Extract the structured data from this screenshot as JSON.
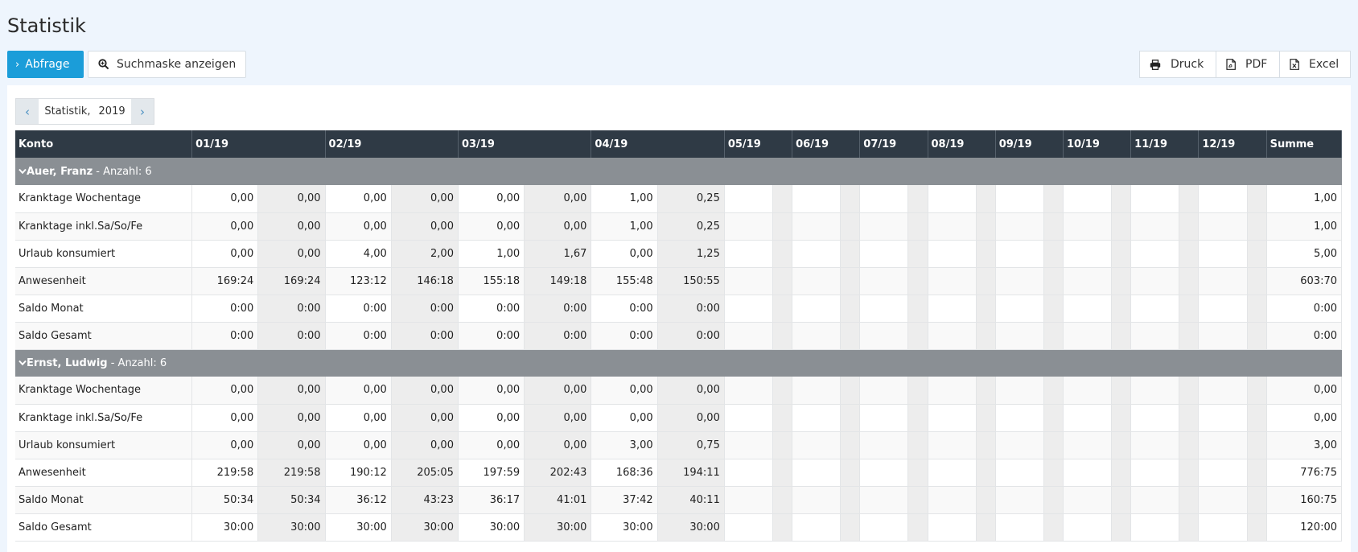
{
  "page": {
    "title": "Statistik"
  },
  "toolbar": {
    "query_label": "Abfrage",
    "search_label": "Suchmaske anzeigen",
    "print_label": "Druck",
    "pdf_label": "PDF",
    "excel_label": "Excel"
  },
  "period": {
    "label": "Statistik,",
    "year": "2019"
  },
  "table": {
    "headers": [
      "Konto",
      "01/19",
      "02/19",
      "03/19",
      "04/19",
      "05/19",
      "06/19",
      "07/19",
      "08/19",
      "09/19",
      "10/19",
      "11/19",
      "12/19",
      "Summe"
    ],
    "groups": [
      {
        "name": "Auer, Franz",
        "count_text": " - Anzahl: 6",
        "rows": [
          {
            "label": "Kranktage Wochentage",
            "values": [
              "0,00",
              "0,00",
              "0,00",
              "0,00",
              "0,00",
              "0,00",
              "1,00",
              "0,25"
            ],
            "sum": "1,00"
          },
          {
            "label": "Kranktage inkl.Sa/So/Fe",
            "values": [
              "0,00",
              "0,00",
              "0,00",
              "0,00",
              "0,00",
              "0,00",
              "1,00",
              "0,25"
            ],
            "sum": "1,00"
          },
          {
            "label": "Urlaub konsumiert",
            "values": [
              "0,00",
              "0,00",
              "4,00",
              "2,00",
              "1,00",
              "1,67",
              "0,00",
              "1,25"
            ],
            "sum": "5,00"
          },
          {
            "label": "Anwesenheit",
            "values": [
              "169:24",
              "169:24",
              "123:12",
              "146:18",
              "155:18",
              "149:18",
              "155:48",
              "150:55"
            ],
            "sum": "603:70"
          },
          {
            "label": "Saldo Monat",
            "values": [
              "0:00",
              "0:00",
              "0:00",
              "0:00",
              "0:00",
              "0:00",
              "0:00",
              "0:00"
            ],
            "sum": "0:00"
          },
          {
            "label": "Saldo Gesamt",
            "values": [
              "0:00",
              "0:00",
              "0:00",
              "0:00",
              "0:00",
              "0:00",
              "0:00",
              "0:00"
            ],
            "sum": "0:00"
          }
        ]
      },
      {
        "name": "Ernst, Ludwig",
        "count_text": " - Anzahl: 6",
        "rows": [
          {
            "label": "Kranktage Wochentage",
            "values": [
              "0,00",
              "0,00",
              "0,00",
              "0,00",
              "0,00",
              "0,00",
              "0,00",
              "0,00"
            ],
            "sum": "0,00"
          },
          {
            "label": "Kranktage inkl.Sa/So/Fe",
            "values": [
              "0,00",
              "0,00",
              "0,00",
              "0,00",
              "0,00",
              "0,00",
              "0,00",
              "0,00"
            ],
            "sum": "0,00"
          },
          {
            "label": "Urlaub konsumiert",
            "values": [
              "0,00",
              "0,00",
              "0,00",
              "0,00",
              "0,00",
              "0,00",
              "3,00",
              "0,75"
            ],
            "sum": "3,00"
          },
          {
            "label": "Anwesenheit",
            "values": [
              "219:58",
              "219:58",
              "190:12",
              "205:05",
              "197:59",
              "202:43",
              "168:36",
              "194:11"
            ],
            "sum": "776:75"
          },
          {
            "label": "Saldo Monat",
            "values": [
              "50:34",
              "50:34",
              "36:12",
              "43:23",
              "36:17",
              "41:01",
              "37:42",
              "40:11"
            ],
            "sum": "160:75"
          },
          {
            "label": "Saldo Gesamt",
            "values": [
              "30:00",
              "30:00",
              "30:00",
              "30:00",
              "30:00",
              "30:00",
              "30:00",
              "30:00"
            ],
            "sum": "120:00"
          }
        ]
      }
    ]
  }
}
